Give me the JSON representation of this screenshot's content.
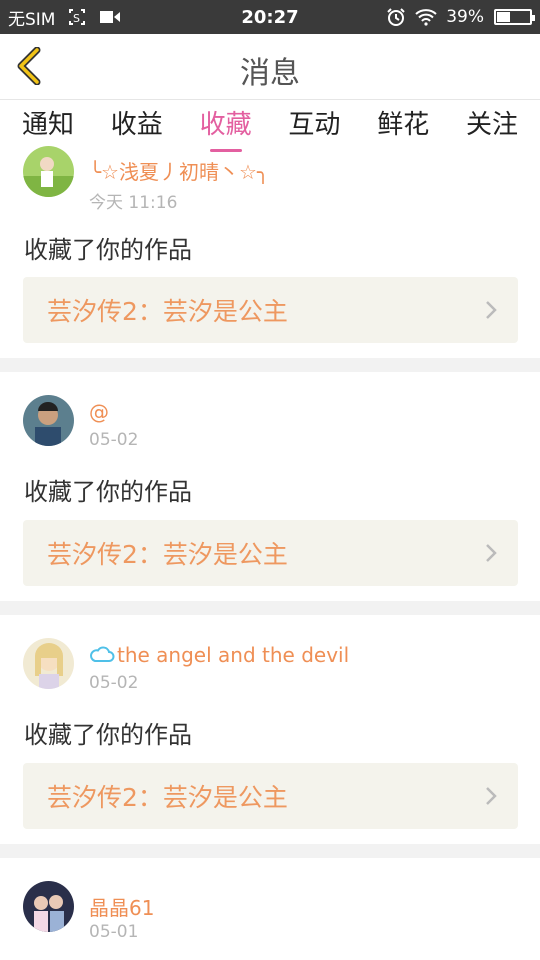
{
  "status_bar": {
    "carrier": "无SIM",
    "time": "20:27",
    "battery_text": "39%",
    "battery_level": 0.39,
    "icons": [
      "screenshot-icon",
      "video-icon",
      "alarm-icon",
      "wifi-icon",
      "battery-icon"
    ]
  },
  "header": {
    "title": "消息",
    "back_icon": "chevron-left-icon",
    "accent": "#f2c417"
  },
  "tabs": [
    {
      "label": "通知",
      "active": false
    },
    {
      "label": "收益",
      "active": false
    },
    {
      "label": "收藏",
      "active": true
    },
    {
      "label": "互动",
      "active": false
    },
    {
      "label": "鲜花",
      "active": false
    },
    {
      "label": "关注",
      "active": false
    }
  ],
  "colors": {
    "active_tab": "#e35fa0",
    "username": "#ef8f55",
    "work_title": "#ee9860",
    "work_box_bg": "#f4f3ec"
  },
  "messages": [
    {
      "username": "╰☆浅夏丿初晴丶☆╮",
      "date": "今天 11:16",
      "action": "收藏了你的作品",
      "work": "芸汐传2：芸汐是公主"
    },
    {
      "username": "@",
      "date": "05-02",
      "action": "收藏了你的作品",
      "work": "芸汐传2：芸汐是公主"
    },
    {
      "username": "the angel and the devil",
      "username_icon": "cloud-icon",
      "date": "05-02",
      "action": "收藏了你的作品",
      "work": "芸汐传2：芸汐是公主"
    },
    {
      "username": "晶晶61",
      "date": "05-01"
    }
  ]
}
